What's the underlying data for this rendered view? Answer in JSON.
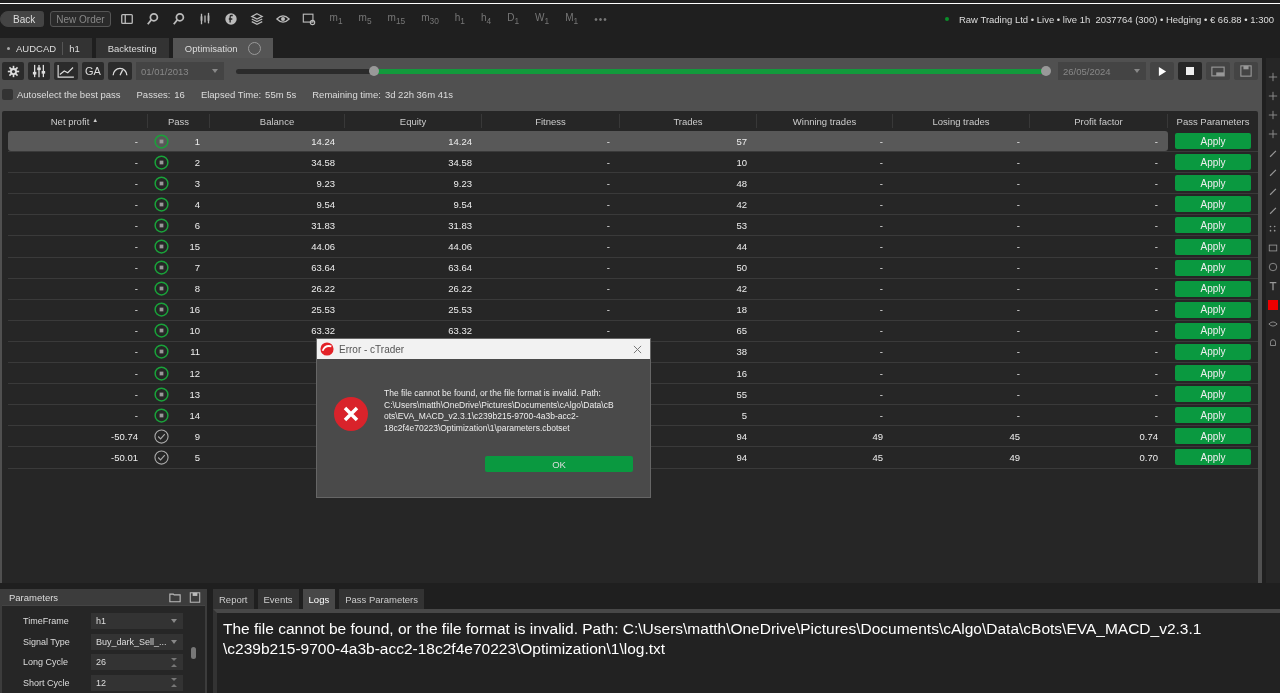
{
  "top_bar": {
    "buttons": [
      {
        "label": "Back",
        "disabled": false
      },
      {
        "label": "New Order",
        "disabled": true
      }
    ],
    "timeframes": [
      "m$_{1}$",
      "m$_{5}$",
      "m$_{15}$",
      "m$_{30}$",
      "h$_{1}$",
      "h$_{4}$",
      "D$_{1}$",
      "W$_{1}$",
      "M$_{1}$"
    ],
    "more": "•••",
    "account": {
      "connected": true,
      "text": "Raw Trading Ltd • Live • live 1h  2037764 (300) • Hedging • € 66.88 • 1:300"
    }
  },
  "tabs": [
    {
      "label": "AUDCAD",
      "sublabel": "h1",
      "selected": false
    },
    {
      "label": "Backtesting",
      "selected": false
    },
    {
      "label": "Optimisation",
      "selected": true
    }
  ],
  "toolbar": {
    "ga_label": "GA",
    "start_date": "01/01/2013",
    "end_date": "26/05/2024",
    "level": 0.83
  },
  "status": {
    "autoselect": {
      "label": "Autoselect the best pass",
      "checked": false
    },
    "stats": [
      {
        "label": "Passes:",
        "value": "16"
      },
      {
        "label": "Elapsed Time:",
        "value": "55m 5s"
      },
      {
        "label": "Remaining time:",
        "value": "3d 22h 36m 41s"
      }
    ]
  },
  "table": {
    "columns": [
      {
        "label": "Net profit",
        "sort_mark": "▲"
      },
      {
        "label": "Pass"
      },
      {
        "label": "Balance"
      },
      {
        "label": "Equity"
      },
      {
        "label": "Fitness"
      },
      {
        "label": "Trades"
      },
      {
        "label": "Winning trades"
      },
      {
        "label": "Losing trades"
      },
      {
        "label": "Profit factor"
      },
      {
        "label": "Pass Parameters"
      }
    ],
    "rows": [
      {
        "net_profit": "-",
        "completed": false,
        "pass": "1",
        "balance": "14.24",
        "equity": "14.24",
        "fitness": "-",
        "trades": "57",
        "winning": "-",
        "losing": "-",
        "profit_factor": "-",
        "action": "Apply",
        "selected": true
      },
      {
        "net_profit": "-",
        "completed": false,
        "pass": "2",
        "balance": "34.58",
        "equity": "34.58",
        "fitness": "-",
        "trades": "10",
        "winning": "-",
        "losing": "-",
        "profit_factor": "-",
        "action": "Apply",
        "selected": false
      },
      {
        "net_profit": "-",
        "completed": false,
        "pass": "3",
        "balance": "9.23",
        "equity": "9.23",
        "fitness": "-",
        "trades": "48",
        "winning": "-",
        "losing": "-",
        "profit_factor": "-",
        "action": "Apply",
        "selected": false
      },
      {
        "net_profit": "-",
        "completed": false,
        "pass": "4",
        "balance": "9.54",
        "equity": "9.54",
        "fitness": "-",
        "trades": "42",
        "winning": "-",
        "losing": "-",
        "profit_factor": "-",
        "action": "Apply",
        "selected": false
      },
      {
        "net_profit": "-",
        "completed": false,
        "pass": "6",
        "balance": "31.83",
        "equity": "31.83",
        "fitness": "-",
        "trades": "53",
        "winning": "-",
        "losing": "-",
        "profit_factor": "-",
        "action": "Apply",
        "selected": false
      },
      {
        "net_profit": "-",
        "completed": false,
        "pass": "15",
        "balance": "44.06",
        "equity": "44.06",
        "fitness": "-",
        "trades": "44",
        "winning": "-",
        "losing": "-",
        "profit_factor": "-",
        "action": "Apply",
        "selected": false
      },
      {
        "net_profit": "-",
        "completed": false,
        "pass": "7",
        "balance": "63.64",
        "equity": "63.64",
        "fitness": "-",
        "trades": "50",
        "winning": "-",
        "losing": "-",
        "profit_factor": "-",
        "action": "Apply",
        "selected": false
      },
      {
        "net_profit": "-",
        "completed": false,
        "pass": "8",
        "balance": "26.22",
        "equity": "26.22",
        "fitness": "-",
        "trades": "42",
        "winning": "-",
        "losing": "-",
        "profit_factor": "-",
        "action": "Apply",
        "selected": false
      },
      {
        "net_profit": "-",
        "completed": false,
        "pass": "16",
        "balance": "25.53",
        "equity": "25.53",
        "fitness": "-",
        "trades": "18",
        "winning": "-",
        "losing": "-",
        "profit_factor": "-",
        "action": "Apply",
        "selected": false
      },
      {
        "net_profit": "-",
        "completed": false,
        "pass": "10",
        "balance": "63.32",
        "equity": "63.32",
        "fitness": "-",
        "trades": "65",
        "winning": "-",
        "losing": "-",
        "profit_factor": "-",
        "action": "Apply",
        "selected": false
      },
      {
        "net_profit": "-",
        "completed": false,
        "pass": "11",
        "trades": "38",
        "winning": "-",
        "losing": "-",
        "profit_factor": "-",
        "action": "Apply",
        "selected": false
      },
      {
        "net_profit": "-",
        "completed": false,
        "pass": "12",
        "trades": "16",
        "winning": "-",
        "losing": "-",
        "profit_factor": "-",
        "action": "Apply",
        "selected": false
      },
      {
        "net_profit": "-",
        "completed": false,
        "pass": "13",
        "trades": "55",
        "winning": "-",
        "losing": "-",
        "profit_factor": "-",
        "action": "Apply",
        "selected": false
      },
      {
        "net_profit": "-",
        "completed": false,
        "pass": "14",
        "trades": "5",
        "winning": "-",
        "losing": "-",
        "profit_factor": "-",
        "action": "Apply",
        "selected": false
      },
      {
        "net_profit": "-50.74",
        "completed": true,
        "pass": "9",
        "trades": "94",
        "winning": "49",
        "losing": "45",
        "profit_factor": "0.74",
        "action": "Apply",
        "selected": false
      },
      {
        "net_profit": "-50.01",
        "completed": true,
        "pass": "5",
        "trades": "94",
        "winning": "45",
        "losing": "49",
        "profit_factor": "0.70",
        "action": "Apply",
        "selected": false
      }
    ]
  },
  "dialog": {
    "title": "Error - cTrader",
    "message": "The file cannot be found, or the file format is invalid. Path: C:\\Users\\matth\\OneDrive\\Pictures\\Documents\\cAlgo\\Data\\cBots\\EVA_MACD_v2.3.1\\c239b215-9700-4a3b-acc2-18c2f4e70223\\Optimization\\1\\parameters.cbotset",
    "button": "OK"
  },
  "parameters": {
    "title": "Parameters",
    "items": [
      {
        "kind": "select",
        "label": "TimeFrame",
        "value": "h1"
      },
      {
        "kind": "select",
        "label": "Signal Type",
        "value": "Buy_dark_Sell_..."
      },
      {
        "kind": "number",
        "label": "Long Cycle",
        "value": "26"
      },
      {
        "kind": "number",
        "label": "Short Cycle",
        "value": "12"
      }
    ]
  },
  "log_tabs": [
    {
      "label": "Report",
      "selected": false
    },
    {
      "label": "Events",
      "selected": false
    },
    {
      "label": "Logs",
      "selected": true
    },
    {
      "label": "Pass Parameters",
      "selected": false
    }
  ],
  "log_lines": [
    "The file cannot be found, or the file format is invalid. Path: C:\\Users\\matth\\OneDrive\\Pictures\\Documents\\cAlgo\\Data\\cBots\\EVA_MACD_v2.3.1",
    "\\c239b215-9700-4a3b-acc2-18c2f4e70223\\Optimization\\1\\log.txt"
  ]
}
